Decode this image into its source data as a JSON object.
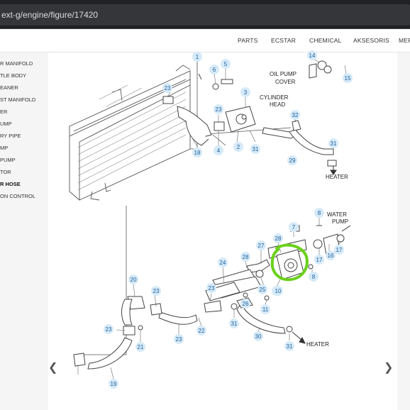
{
  "browser": {
    "url_text": "ext-g/engine/figure/17420"
  },
  "nav": {
    "items": [
      "PARTS",
      "ECSTAR",
      "CHEMICAL",
      "AKSESORIS",
      "MER"
    ]
  },
  "sidebar": {
    "items": [
      {
        "label": "R MANIFOLD",
        "active": false
      },
      {
        "label": "TLE BODY",
        "active": false
      },
      {
        "label": "EANER",
        "active": false
      },
      {
        "label": "ST MANIFOLD",
        "active": false
      },
      {
        "label": "ER",
        "active": false
      },
      {
        "label": "UMP",
        "active": false
      },
      {
        "label": "RY PIPE",
        "active": false
      },
      {
        "label": "MP",
        "active": false
      },
      {
        "label": " PUMP",
        "active": false
      },
      {
        "label": "TOR",
        "active": false
      },
      {
        "label": "R HOSE",
        "active": true
      },
      {
        "label": "ON CONTROL",
        "active": false
      }
    ]
  },
  "diagram": {
    "labels": {
      "oil_pump_cover_1": "OIL PUMP",
      "oil_pump_cover_2": "COVER",
      "cylinder_head_1": "CYLINDER",
      "cylinder_head_2": "HEAD",
      "heater_top": "HEATER",
      "water_pump_1": "WATER",
      "water_pump_2": "PUMP",
      "heater_bottom": "HEATER"
    },
    "callouts": [
      "1",
      "6",
      "5",
      "14",
      "15",
      "23",
      "3",
      "23",
      "2",
      "4",
      "18",
      "31",
      "32",
      "31",
      "29",
      "8",
      "7",
      "28",
      "17",
      "16",
      "17",
      "28",
      "27",
      "9",
      "25",
      "10",
      "8",
      "24",
      "26",
      "11",
      "20",
      "23",
      "23",
      "22",
      "23",
      "31",
      "30",
      "31",
      "21",
      "23",
      "19"
    ],
    "highlight_color": "#6ad11a",
    "callout_fill": "#d6eaf8"
  },
  "controls": {
    "prev_glyph": "❮",
    "next_glyph": "❯"
  }
}
